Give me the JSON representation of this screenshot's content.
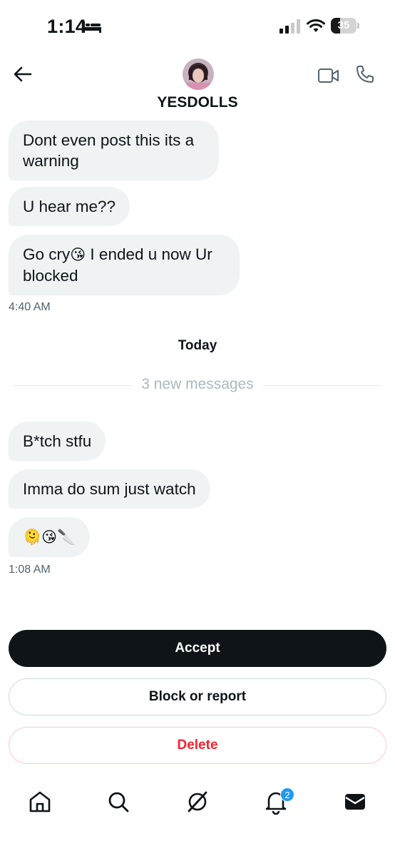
{
  "status_bar": {
    "time": "1:14",
    "battery": "35",
    "battery_level": 0.35
  },
  "header": {
    "title": "YESDOLLS",
    "icons": [
      "back-arrow-icon",
      "avatar",
      "video-icon",
      "phone-icon"
    ]
  },
  "messages_before": [
    {
      "text": "Dont even post this its a warning"
    },
    {
      "text": "U hear me??"
    },
    {
      "text_a": "Go cry",
      "emoji": "😘",
      "text_b": " I ended u now Ur blocked"
    }
  ],
  "time_1": "4:40 AM",
  "day_label": "Today",
  "new_messages_label": "3 new messages",
  "messages_after": [
    {
      "text": "B*tch stfu"
    },
    {
      "text": "Imma do sum just watch"
    },
    {
      "text": "🫠😘🔪"
    }
  ],
  "time_2": "1:08 AM",
  "actions": {
    "accept": "Accept",
    "block": "Block or report",
    "delete": "Delete"
  },
  "tab_bar": {
    "tabs": [
      "home-icon",
      "search-icon",
      "grok-icon",
      "bell-icon",
      "mail-icon"
    ],
    "notification_count": "2"
  },
  "colors": {
    "bubble": "#eff3f4",
    "primary": "#0f1419",
    "accent": "#1d9bf0",
    "delete": "#f4212e"
  }
}
